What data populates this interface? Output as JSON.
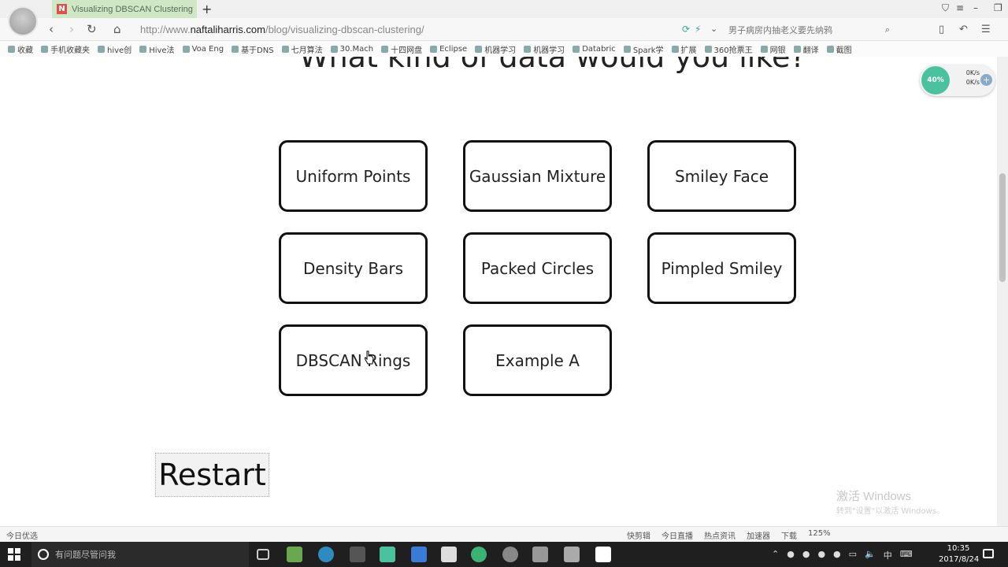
{
  "browser": {
    "tab_title": "Visualizing DBSCAN Clustering",
    "tab_favicon": "N",
    "new_tab_label": "+",
    "url_scheme": "http://www.",
    "url_host": "naftaliharris.com",
    "url_path": "/blog/visualizing-dbscan-clustering/",
    "search_placeholder": "男子病房内抽老义要先纳鸦",
    "bookmarks": [
      "收藏",
      "手机收藏夹",
      "hive创",
      "Hive法",
      "Voa Eng",
      "基于DNS",
      "七月算法",
      "30.Mach",
      "十四网盘",
      "Eclipse",
      "机器学习",
      "机器学习",
      "Databric",
      "Spark学",
      "扩展",
      "360抢票王",
      "网银",
      "翻译",
      "截图"
    ]
  },
  "page": {
    "heading": "What kind of data would you like?",
    "options": [
      {
        "label": "Uniform Points"
      },
      {
        "label": "Gaussian Mixture"
      },
      {
        "label": "Smiley Face"
      },
      {
        "label": "Density Bars"
      },
      {
        "label": "Packed Circles"
      },
      {
        "label": "Pimpled Smiley"
      },
      {
        "label": "DBSCAN Rings"
      },
      {
        "label": "Example A"
      }
    ],
    "restart_label": "Restart"
  },
  "net_widget": {
    "percent": "40%",
    "up_rate": "0K/s",
    "down_rate": "0K/s"
  },
  "activation": {
    "title": "激活 Windows",
    "subtitle": "转到\"设置\"以激活 Windows。"
  },
  "statusbar": {
    "left": "今日优选",
    "right": [
      "快剪辑",
      "今日直播",
      "热点资讯",
      "加速器",
      "下载",
      "125%"
    ]
  },
  "taskbar": {
    "search_placeholder": "有问题尽管问我",
    "input_method": "中",
    "time": "10:35",
    "date": "2017/8/24"
  },
  "colors": {
    "tab_active": "#cfe7c4",
    "button_border": "#111111",
    "taskbar": "#1f1f1f",
    "net_ring": "#4cc1a0"
  }
}
